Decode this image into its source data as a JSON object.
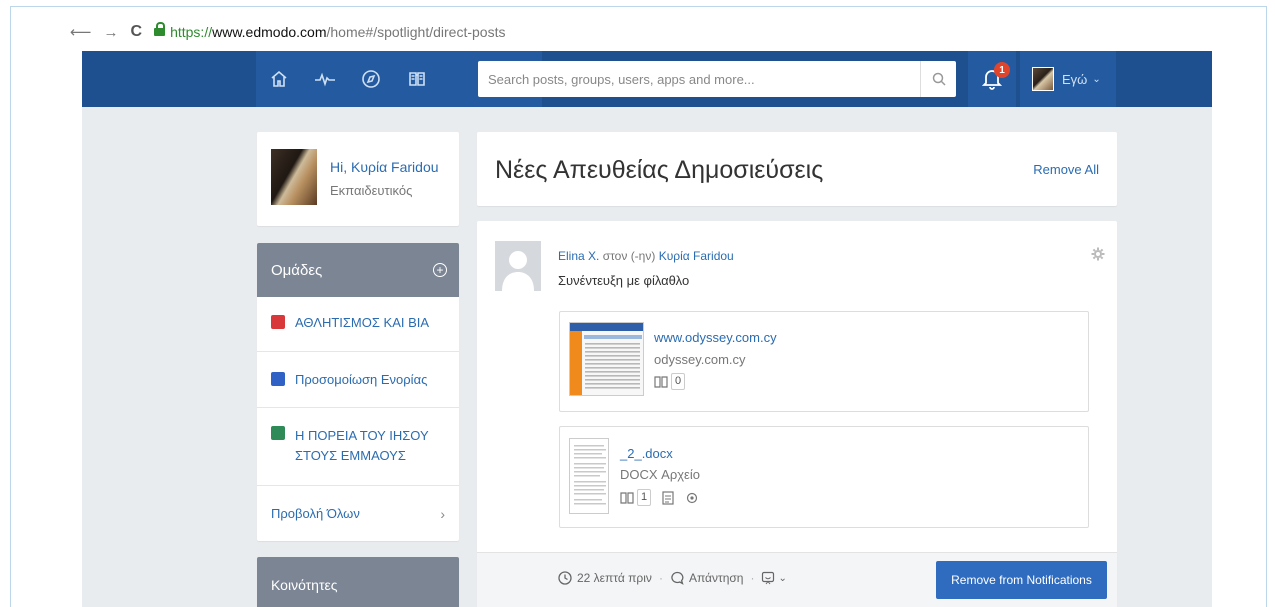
{
  "browser": {
    "back_glyph": "⟵",
    "forward_glyph": "→",
    "reload_glyph": "C",
    "url_scheme": "https://",
    "url_host": "www.edmodo.com",
    "url_path": "/home#/spotlight/direct-posts"
  },
  "topbar": {
    "nav_icons": [
      "home-icon",
      "activity-icon",
      "discover-icon",
      "backpack-icon"
    ],
    "search_placeholder": "Search posts, groups, users, apps and more...",
    "notification_count": "1",
    "user_label": "Εγώ",
    "color": "#1e4f8f"
  },
  "sidebar": {
    "profile": {
      "greeting": "Hi, Κυρία Faridou",
      "role": "Εκπαιδευτικός"
    },
    "groups": {
      "title": "Ομάδες",
      "items": [
        {
          "line1": "ΑΘΛΗΤΙΣΜΟΣ ΚΑΙ ΒΙΑ",
          "line2": "",
          "color": "#d9383a"
        },
        {
          "line1": "Προσομοίωση Ενορίας",
          "line2": "",
          "color": "#2f62c4"
        },
        {
          "line1": "Η ΠΟΡΕΙΑ ΤΟΥ ΙΗΣΟΥ",
          "line2": "ΣΤΟΥΣ ΕΜΜΑΟΥΣ",
          "color": "#2e8a56"
        }
      ],
      "view_all": "Προβολή Όλων"
    },
    "communities_title": "Κοινότητες"
  },
  "main": {
    "title": "Νέες Απευθείας Δημοσιεύσεις",
    "remove_all": "Remove All",
    "post": {
      "author": "Elina X.",
      "to_text": "στον (-ην)",
      "recipient": "Κυρία Faridou",
      "message": "Συνέντευξη με φίλαθλο",
      "attachments": [
        {
          "title": "www.odyssey.com.cy",
          "subtitle": "odyssey.com.cy",
          "backpack_count": "0"
        },
        {
          "title": "_2_.docx",
          "subtitle": "DOCX Αρχείο",
          "backpack_count": "1"
        }
      ],
      "time": "22 λεπτά πριν",
      "reply": "Απάντηση",
      "remove_button": "Remove from Notifications"
    }
  }
}
